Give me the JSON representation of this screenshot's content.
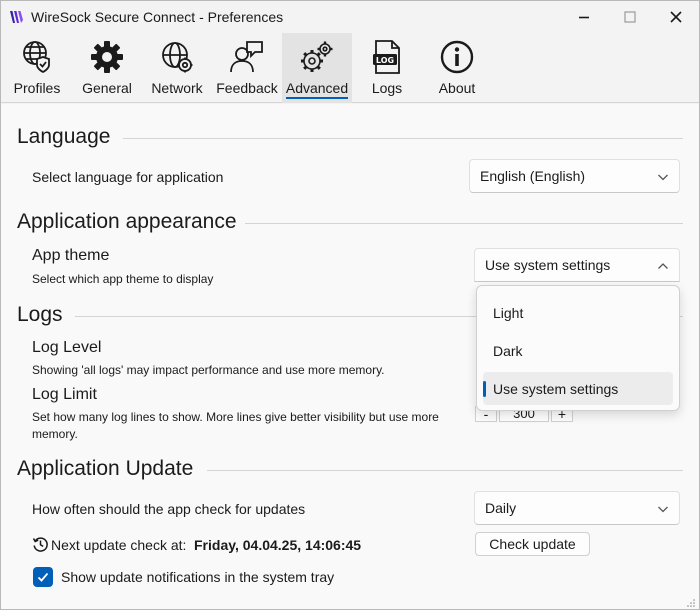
{
  "window": {
    "title": "WireSock Secure Connect - Preferences"
  },
  "toolbar": {
    "items": [
      {
        "label": "Profiles",
        "icon": "profiles-globe-shield-icon"
      },
      {
        "label": "General",
        "icon": "gear-icon"
      },
      {
        "label": "Network",
        "icon": "network-globe-gear-icon"
      },
      {
        "label": "Feedback",
        "icon": "feedback-person-icon"
      },
      {
        "label": "Advanced",
        "icon": "gears-icon",
        "active": true
      },
      {
        "label": "Logs",
        "icon": "log-file-icon"
      },
      {
        "label": "About",
        "icon": "info-icon"
      }
    ]
  },
  "language": {
    "title": "Language",
    "label": "Select language for application",
    "value": "English (English)"
  },
  "appearance": {
    "title": "Application appearance",
    "theme_label": "App theme",
    "theme_sub": "Select which app theme to display",
    "theme_value": "Use system settings",
    "options": [
      "Light",
      "Dark",
      "Use system settings"
    ],
    "selected_index": 2
  },
  "logs": {
    "title": "Logs",
    "level_label": "Log Level",
    "level_sub": "Showing 'all logs' may impact performance and use more memory.",
    "limit_label": "Log Limit",
    "limit_sub_line1": "Set how many log lines to show. More lines give better visibility but use more",
    "limit_sub_line2": "memory.",
    "limit_value": "300",
    "minus": "-",
    "plus": "+"
  },
  "update": {
    "title": "Application Update",
    "freq_label": "How often should the app check for updates",
    "freq_value": "Daily",
    "next_label": "Next update check at:",
    "next_value": "Friday, 04.04.25, 14:06:45",
    "check_button": "Check update",
    "notify_label": "Show update notifications in the system tray",
    "notify_checked": true
  },
  "colors": {
    "accent": "#005fb8",
    "brand_logo": "#5b2bd6"
  }
}
